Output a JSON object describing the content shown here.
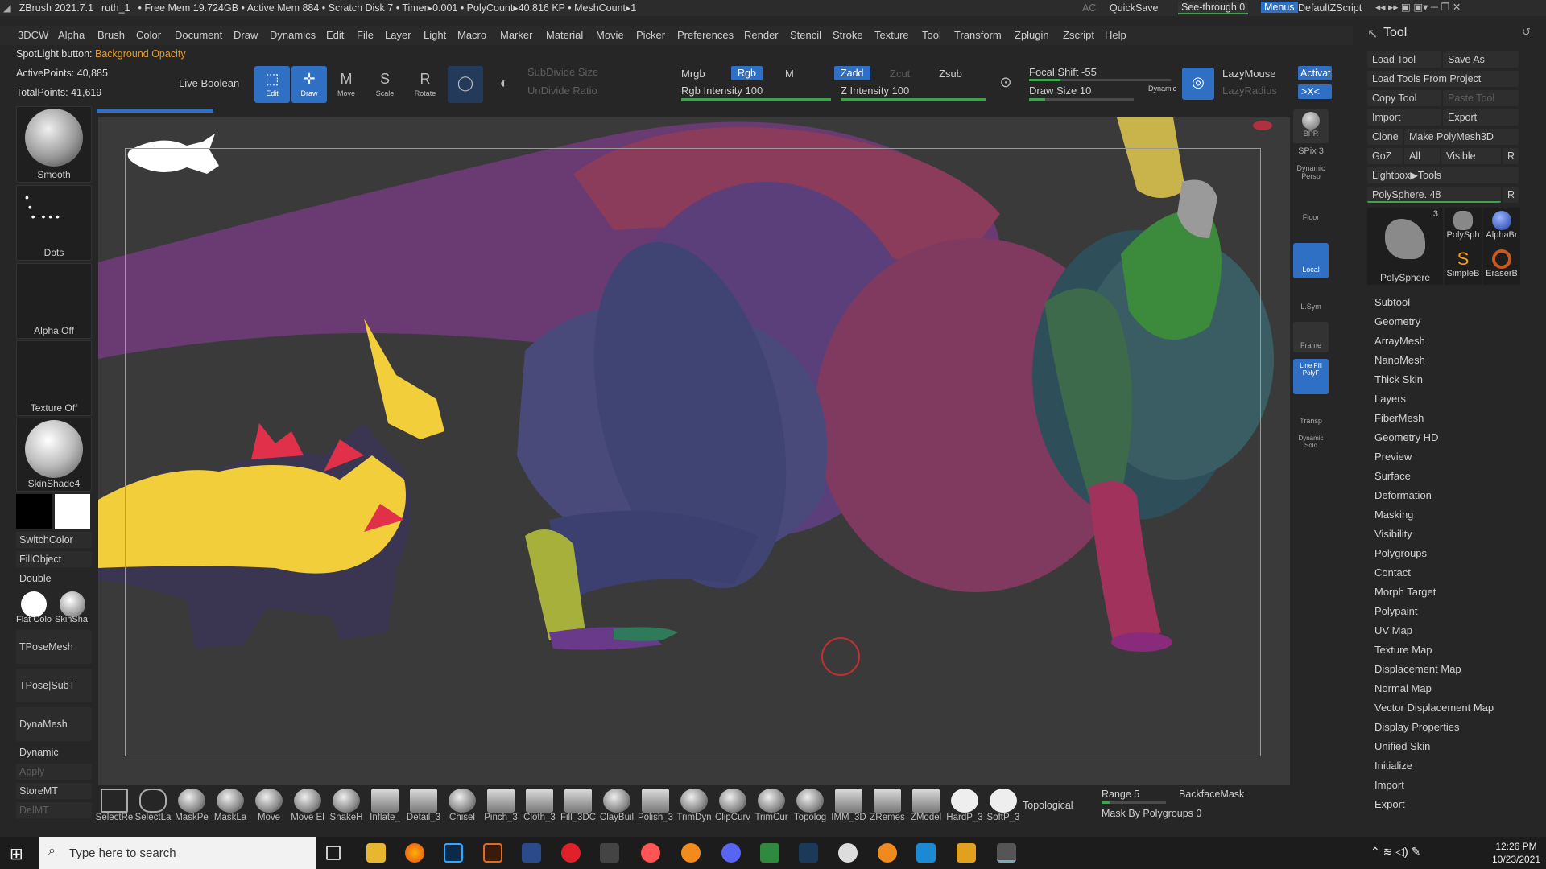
{
  "titlebar": {
    "app": "ZBrush 2021.7.1",
    "doc": "ruth_1",
    "stats": "• Free Mem 19.724GB • Active Mem 884 • Scratch Disk 7 • Timer▸0.001 • PolyCount▸40.816 KP • MeshCount▸1",
    "ac": "AC",
    "quicksave": "QuickSave",
    "seethrough": "See-through 0",
    "menus": "Menus",
    "script": "DefaultZScript"
  },
  "menu": [
    "3DCW",
    "Alpha",
    "Brush",
    "Color",
    "Document",
    "Draw",
    "Dynamics",
    "Edit",
    "File",
    "Layer",
    "Light",
    "Macro",
    "Marker",
    "Material",
    "Movie",
    "Picker",
    "Preferences",
    "Render",
    "Stencil",
    "Stroke",
    "Texture",
    "Tool",
    "Transform",
    "Zplugin",
    "Zscript",
    "Help"
  ],
  "spotlight": {
    "label": "SpotLight button:",
    "value": "Background Opacity"
  },
  "stats": {
    "active": "ActivePoints: 40,885",
    "total": "TotalPoints: 41,619"
  },
  "toptools": {
    "live_boolean": "Live Boolean",
    "edit": "Edit",
    "draw": "Draw",
    "move": "Move",
    "scale": "Scale",
    "rotate": "Rotate",
    "subdivide_size": "SubDivide Size",
    "undivide_ratio": "UnDivide Ratio",
    "mrgb": "Mrgb",
    "rgb": "Rgb",
    "m": "M",
    "rgb_intensity": "Rgb Intensity 100",
    "zadd": "Zadd",
    "zcut": "Zcut",
    "zsub": "Zsub",
    "z_intensity": "Z Intensity 100",
    "focal_shift": "Focal Shift -55",
    "draw_size": "Draw Size 10",
    "dynamic": "Dynamic",
    "lazymouse": "LazyMouse",
    "lazyradius": "LazyRadius",
    "activate": "Activat",
    "xsym": ">X<"
  },
  "left": {
    "smooth": "Smooth",
    "dots": "Dots",
    "alpha_off": "Alpha Off",
    "texture_off": "Texture Off",
    "material": "SkinShade4",
    "switchcolor": "SwitchColor",
    "fillobject": "FillObject",
    "double": "Double",
    "flat_color": "Flat Colo",
    "skin_shade": "SkinSha",
    "tposemesh": "TPoseMesh",
    "tpose_subt": "TPose|SubT",
    "dynamesh": "DynaMesh",
    "dynamic": "Dynamic",
    "apply": "Apply",
    "storemt": "StoreMT",
    "delmt": "DelMT"
  },
  "right_strip": [
    "BPR",
    "SPix 3",
    "Dynamic Persp",
    "Floor",
    "Local",
    "L.Sym",
    "Frame",
    "Line Fill PolyF",
    "Transp",
    "Dynamic Solo"
  ],
  "toolpanel": {
    "title": "Tool",
    "load_tool": "Load Tool",
    "save_as": "Save As",
    "load_from_project": "Load Tools From Project",
    "copy_tool": "Copy Tool",
    "paste_tool": "Paste Tool",
    "import": "Import",
    "export": "Export",
    "clone": "Clone",
    "make_polymesh": "Make PolyMesh3D",
    "goz": "GoZ",
    "all": "All",
    "visible": "Visible",
    "r": "R",
    "lightbox": "Lightbox▶Tools",
    "polysphere_slider": "PolySphere. 48",
    "thumbs": [
      "PolySphere",
      "PolySph",
      "AlphaBr",
      "SimpleB",
      "EraserB"
    ],
    "thumb_count": "3",
    "sections": [
      "Subtool",
      "Geometry",
      "ArrayMesh",
      "NanoMesh",
      "Thick Skin",
      "Layers",
      "FiberMesh",
      "Geometry HD",
      "Preview",
      "Surface",
      "Deformation",
      "Masking",
      "Visibility",
      "Polygroups",
      "Contact",
      "Morph Target",
      "Polypaint",
      "UV Map",
      "Texture Map",
      "Displacement Map",
      "Normal Map",
      "Vector Displacement Map",
      "Display Properties",
      "Unified Skin",
      "Initialize",
      "Import",
      "Export"
    ]
  },
  "bottom_brushes": [
    "SelectRe",
    "SelectLa",
    "MaskPe",
    "MaskLa",
    "Move",
    "Move El",
    "SnakeH",
    "Inflate_",
    "Detail_3",
    "Chisel",
    "Pinch_3",
    "Cloth_3",
    "Fill_3DC",
    "ClayBuil",
    "Polish_3",
    "TrimDyn",
    "ClipCurv",
    "TrimCur",
    "Topolog",
    "IMM_3D",
    "ZRemes",
    "ZModel",
    "HardP_3",
    "SoftP_3"
  ],
  "bottom_right": {
    "topological": "Topological",
    "range": "Range 5",
    "backface": "BackfaceMask",
    "mask_polygroups": "Mask By Polygroups 0"
  },
  "taskbar": {
    "search_placeholder": "Type here to search",
    "time": "12:26 PM",
    "date": "10/23/2021"
  }
}
